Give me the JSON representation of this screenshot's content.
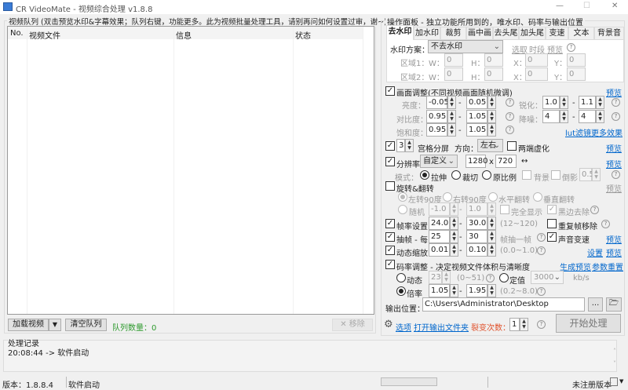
{
  "window": {
    "title": "CR VideoMate - 视频综合处理 v1.8.8",
    "minimize": "—",
    "maximize": "☐",
    "close": "✕"
  },
  "queue": {
    "group_label": "视频队列 (双击预览水印&字幕效果；队列右键，功能更多。此为视频批量处理工具，请别再问如何设置过审，谢~)",
    "columns": [
      "No.",
      "视频文件",
      "信息",
      "状态"
    ],
    "load_button": "加载视频",
    "clear_button": "清空队列",
    "count_label": "队列数量：0",
    "remove_button": "✕ 移除"
  },
  "log": {
    "group_label": "处理记录",
    "entries": [
      "20:08:44 -> 软件启动"
    ]
  },
  "status_bar": {
    "version": "版本：1.8.8.4",
    "message": "软件启动",
    "registration": "未注册版本"
  },
  "panel": {
    "group_label": "操作面板 - 独立功能所用到的，唯水印、码率与输出位置",
    "tabs": [
      "去水印",
      "加水印",
      "裁剪",
      "画中画",
      "去头尾",
      "加头尾",
      "变速",
      "文本",
      "背景音"
    ],
    "watermark": {
      "label": "水印方案：",
      "value": "不去水印",
      "pick": "选取",
      "period": "时段",
      "preview": "预览",
      "region1": "区域1：",
      "region2": "区域2：",
      "w": "W：",
      "h": "H：",
      "x": "X：",
      "y": "Y：",
      "zero": "0"
    },
    "adjust": {
      "label": "画面调整(不同视频画面随机微调)",
      "checked": true,
      "preview": "预览",
      "brightness": "亮度：",
      "b_min": "-0.05",
      "b_max": "0.05",
      "contrast": "对比度：",
      "c_min": "0.95",
      "c_max": "1.05",
      "saturation": "饱和度：",
      "s_min": "0.95",
      "s_max": "1.05",
      "sharpen": "锐化：",
      "sh_min": "1.0",
      "sh_max": "1.1",
      "denoise": "降噪：",
      "d_min": "4",
      "d_max": "4",
      "lut": "lut滤镜",
      "more": "更多效果"
    },
    "grid": {
      "checked": true,
      "value": "3",
      "label": "宫格分屏",
      "direction": "方向：",
      "direction_value": "左右",
      "blur": "两端虚化",
      "preview": "预览"
    },
    "resolution": {
      "checked": true,
      "label": "分辨率",
      "preset": "自定义",
      "width": "1280",
      "x": "x",
      "height": "720",
      "swap": "↔",
      "preview": "预览",
      "mode": "模式：",
      "stretch": "拉伸",
      "crop": "裁切",
      "ratio": "原比例",
      "background": "背景",
      "reflection": "倒影",
      "reflection_value": "0.5",
      "selected_mode": "拉伸"
    },
    "rotate": {
      "checked": false,
      "label": "旋转&翻转",
      "preview": "预览",
      "left90": "左转90度",
      "right90": "右转90度",
      "hflip": "水平翻转",
      "vflip": "垂直翻转",
      "random": "随机",
      "r_min": "-1.0",
      "r_max": "1.0",
      "full": "完全显示",
      "black": "黑边去除"
    },
    "framerate": {
      "checked": true,
      "label": "帧率设置",
      "min": "24.0",
      "max": "30.0",
      "range": "(12~120)",
      "dup": "重复帧移除",
      "dup_checked": false
    },
    "drop": {
      "checked": true,
      "label": "抽帧 - 每",
      "min": "25",
      "max": "30",
      "suffix": "帧抽一帧",
      "audio": "声音变速",
      "audio_checked": true,
      "preview": "预览"
    },
    "zoom": {
      "checked": true,
      "label": "动态缩放",
      "min": "0.01",
      "max": "0.10",
      "range": "(0.0~1.0)",
      "settings": "设置",
      "preview": "预览"
    },
    "bitrate": {
      "checked": true,
      "label": "码率调整 - 决定视频文件体积与清晰度",
      "gen_preview": "生成预览",
      "reset": "参数重置",
      "dynamic": "动态",
      "crf": "23",
      "crf_range": "(0~51)",
      "fixed": "定值",
      "fixed_value": "3000",
      "unit": "kb/s",
      "ratio": "倍率",
      "ratio_min": "1.05",
      "ratio_max": "1.95",
      "ratio_range": "(0.2~8.0)",
      "selected": "倍率"
    },
    "output": {
      "label": "输出位置：",
      "path": "C:\\Users\\Administrator\\Desktop",
      "browse": "..."
    },
    "bottom": {
      "options": "选项",
      "open_folder": "打开输出文件夹",
      "fission": "裂变次数：",
      "fission_value": "1",
      "start": "开始处理"
    },
    "dash": "-",
    "help": "?"
  },
  "colors": {
    "link": "#0066cc",
    "count_green": "#2e9a2e",
    "fission_red": "#e0502a"
  }
}
